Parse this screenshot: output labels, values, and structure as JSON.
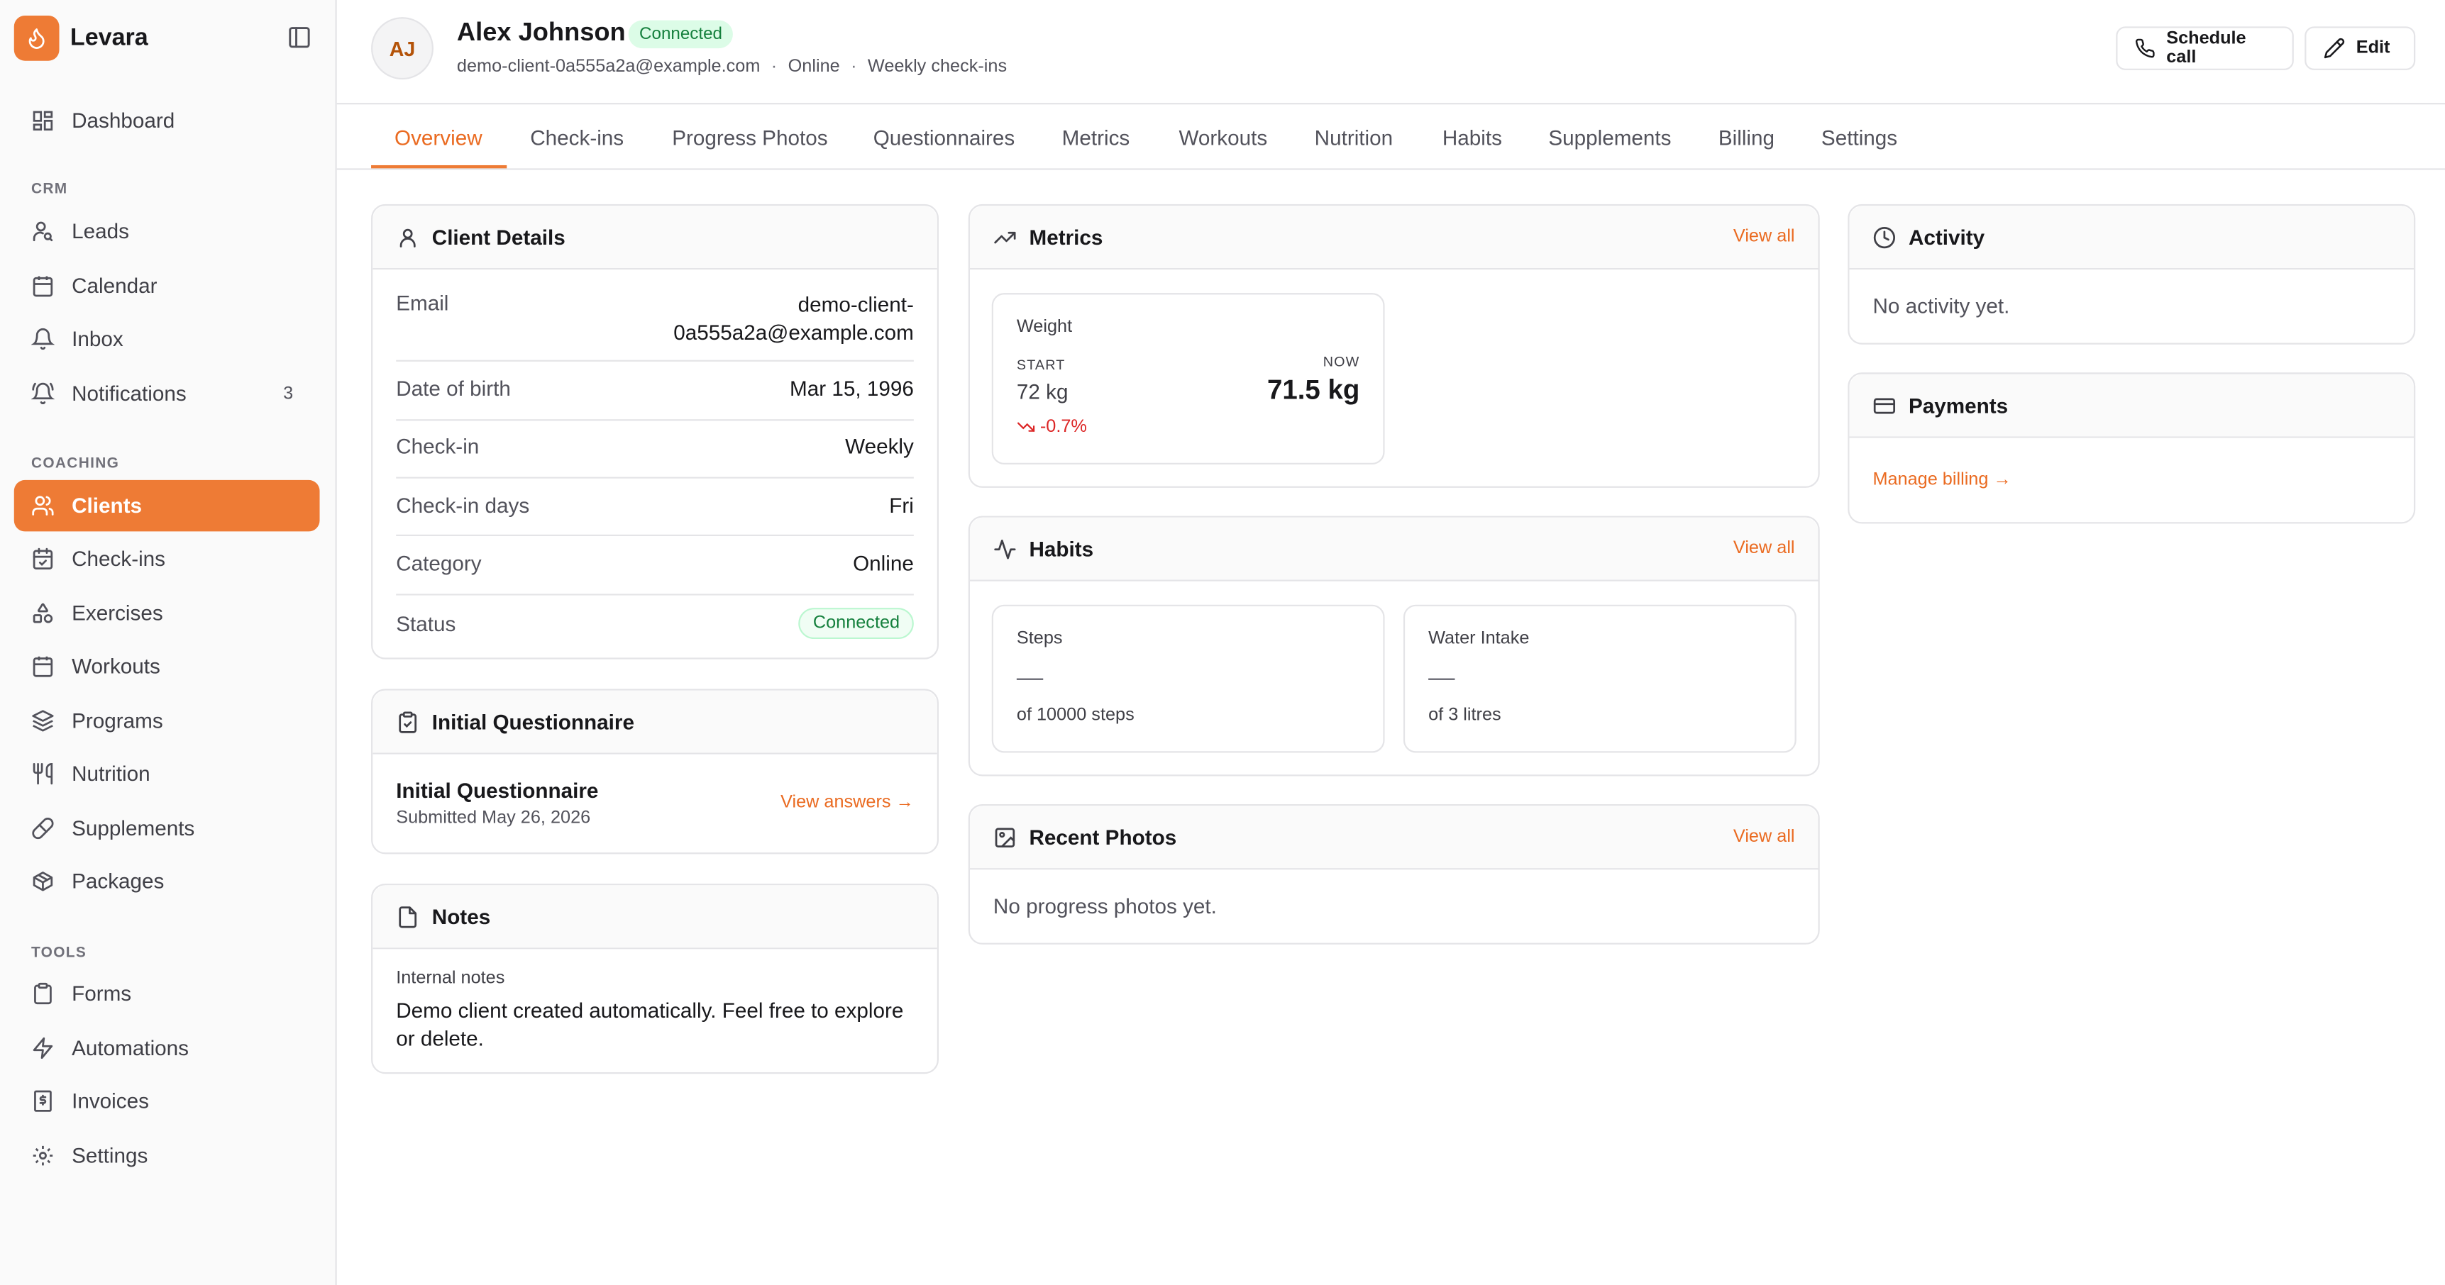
{
  "app": {
    "name": "Levara",
    "accent": "#ee7b35"
  },
  "sidebar": {
    "dashboard": "Dashboard",
    "sections": {
      "crm": "CRM",
      "coaching": "COACHING",
      "tools": "TOOLS"
    },
    "crm": [
      {
        "label": "Leads",
        "icon": "user-search-icon"
      },
      {
        "label": "Calendar",
        "icon": "calendar-icon"
      },
      {
        "label": "Inbox",
        "icon": "bell-icon"
      },
      {
        "label": "Notifications",
        "icon": "bell-ring-icon",
        "badge": "3"
      }
    ],
    "coaching": [
      {
        "label": "Clients",
        "icon": "users-icon"
      },
      {
        "label": "Check-ins",
        "icon": "calendar-check-icon"
      },
      {
        "label": "Exercises",
        "icon": "shapes-icon"
      },
      {
        "label": "Workouts",
        "icon": "calendar-icon"
      },
      {
        "label": "Programs",
        "icon": "layers-icon"
      },
      {
        "label": "Nutrition",
        "icon": "utensils-icon"
      },
      {
        "label": "Supplements",
        "icon": "pill-icon"
      },
      {
        "label": "Packages",
        "icon": "package-icon"
      }
    ],
    "tools": [
      {
        "label": "Forms",
        "icon": "clipboard-icon"
      },
      {
        "label": "Automations",
        "icon": "zap-icon"
      },
      {
        "label": "Invoices",
        "icon": "receipt-icon"
      },
      {
        "label": "Settings",
        "icon": "gear-icon"
      }
    ]
  },
  "client": {
    "initials": "AJ",
    "name": "Alex Johnson",
    "status": "Connected",
    "email": "demo-client-0a555a2a@example.com",
    "mode": "Online",
    "cadence": "Weekly check-ins"
  },
  "header_actions": {
    "schedule": "Schedule call",
    "edit": "Edit"
  },
  "tabs": [
    "Overview",
    "Check-ins",
    "Progress Photos",
    "Questionnaires",
    "Metrics",
    "Workouts",
    "Nutrition",
    "Habits",
    "Supplements",
    "Billing",
    "Settings"
  ],
  "client_details": {
    "title": "Client Details",
    "email_label": "Email",
    "email_value_line1": "demo-client-",
    "email_value_line2": "0a555a2a@example.com",
    "rows": [
      {
        "label": "Date of birth",
        "value": "Mar 15, 1996"
      },
      {
        "label": "Check-in",
        "value": "Weekly"
      },
      {
        "label": "Check-in days",
        "value": "Fri"
      },
      {
        "label": "Category",
        "value": "Online"
      }
    ],
    "status_label": "Status",
    "status_value": "Connected"
  },
  "questionnaire": {
    "title": "Initial Questionnaire",
    "item_title": "Initial Questionnaire",
    "submitted": "Submitted May 26, 2026",
    "link": "View answers →"
  },
  "notes": {
    "title": "Notes",
    "label": "Internal notes",
    "body": "Demo client created automatically. Feel free to explore or delete."
  },
  "metrics": {
    "title": "Metrics",
    "view_all": "View all",
    "weight": {
      "label": "Weight",
      "start_label": "START",
      "start_value": "72 kg",
      "now_label": "NOW",
      "now_value": "71.5 kg",
      "change": "-0.7%"
    }
  },
  "habits": {
    "title": "Habits",
    "view_all": "View all",
    "items": [
      {
        "label": "Steps",
        "value": "—",
        "target": "of 10000 steps"
      },
      {
        "label": "Water Intake",
        "value": "—",
        "target": "of 3 litres"
      }
    ]
  },
  "photos": {
    "title": "Recent Photos",
    "view_all": "View all",
    "empty": "No progress photos yet."
  },
  "activity": {
    "title": "Activity",
    "empty": "No activity yet."
  },
  "payments": {
    "title": "Payments",
    "link": "Manage billing →"
  }
}
